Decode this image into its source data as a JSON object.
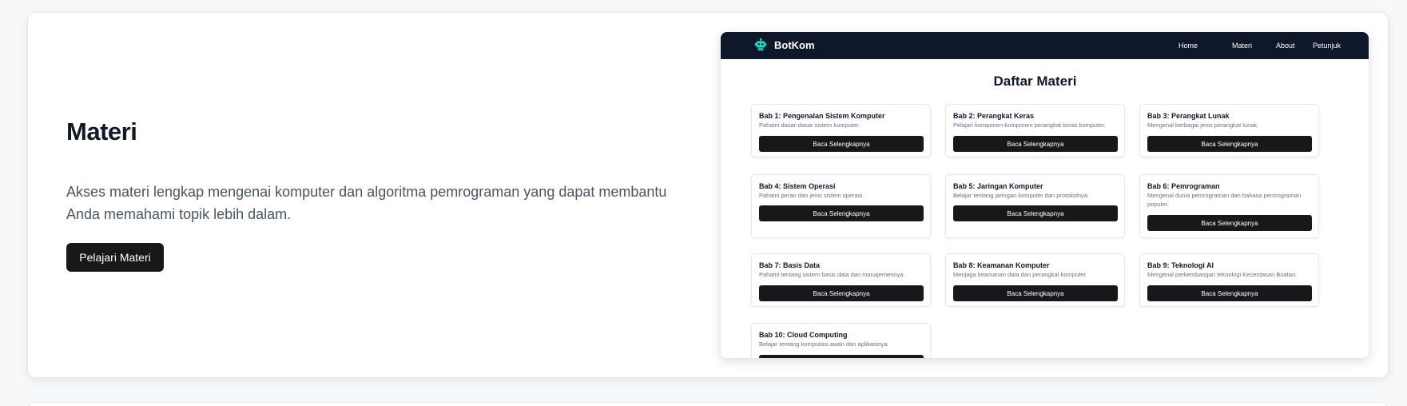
{
  "hero": {
    "title": "Materi",
    "description": "Akses materi lengkap mengenai komputer dan algoritma pemrograman yang dapat membantu Anda memahami topik lebih dalam.",
    "button_label": "Pelajari Materi"
  },
  "preview": {
    "brand": "BotKom",
    "brand_icon": "robot-icon",
    "nav": [
      "Home",
      "Materi",
      "About",
      "Petunjuk"
    ],
    "page_title": "Daftar Materi",
    "read_more_label": "Baca Selengkapnya",
    "chapters": [
      {
        "title": "Bab 1: Pengenalan Sistem Komputer",
        "desc": "Pahami dasar-dasar sistem komputer."
      },
      {
        "title": "Bab 2: Perangkat Keras",
        "desc": "Pelajari komponen-komponen perangkat keras komputer."
      },
      {
        "title": "Bab 3: Perangkat Lunak",
        "desc": "Mengenal berbagai jenis perangkat lunak."
      },
      {
        "title": "Bab 4: Sistem Operasi",
        "desc": "Pahami peran dan jenis sistem operasi."
      },
      {
        "title": "Bab 5: Jaringan Komputer",
        "desc": "Belajar tentang jaringan komputer dan protokolnya."
      },
      {
        "title": "Bab 6: Pemrograman",
        "desc": "Mengenal dunia pemrograman dan bahasa pemrograman populer."
      },
      {
        "title": "Bab 7: Basis Data",
        "desc": "Pahami tentang sistem basis data dan manajemennya."
      },
      {
        "title": "Bab 8: Keamanan Komputer",
        "desc": "Menjaga keamanan data dan perangkat komputer."
      },
      {
        "title": "Bab 9: Teknologi AI",
        "desc": "Mengenal perkembangan teknologi Kecerdasan Buatan."
      },
      {
        "title": "Bab 10: Cloud Computing",
        "desc": "Belajar tentang komputasi awan dan aplikasinya."
      }
    ]
  },
  "colors": {
    "page_bg": "#f7f8fa",
    "nav_bg": "#0f172a",
    "button_bg": "#18181b",
    "brand_icon": "#2dd4bf"
  }
}
